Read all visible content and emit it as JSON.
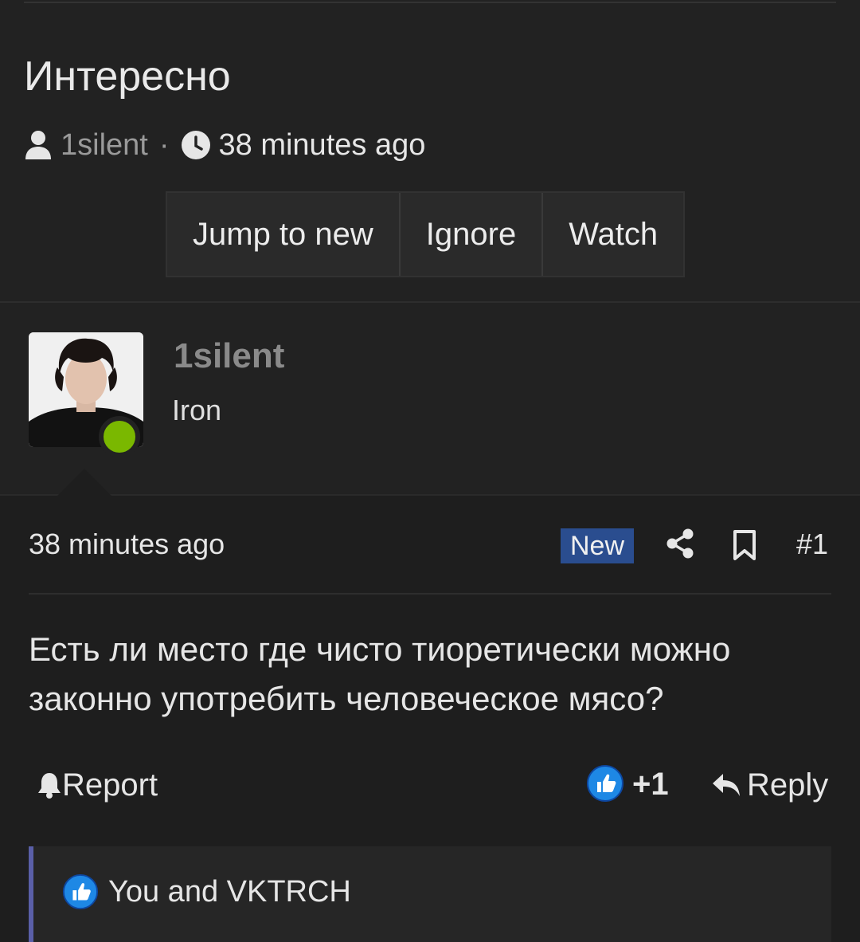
{
  "thread": {
    "title": "Интересно",
    "author": "1silent",
    "separator": "·",
    "time": "38 minutes ago"
  },
  "actions": {
    "jump_to_new": "Jump to new",
    "ignore": "Ignore",
    "watch": "Watch"
  },
  "user": {
    "name": "1silent",
    "title": "Iron",
    "status": "online"
  },
  "post": {
    "time": "38 minutes ago",
    "badge": "New",
    "number": "#1",
    "body": "Есть ли место где чисто тиоретически можно законно употребить человеческое мясо?",
    "report_label": "Report",
    "like_count": "+1",
    "reply_label": "Reply",
    "reactions_text": "You and VKTRCH"
  },
  "icons": {
    "author": "user-icon",
    "time": "clock-icon",
    "share": "share-icon",
    "bookmark": "bookmark-icon",
    "report": "bell-icon",
    "like": "thumbs-up-icon",
    "reply": "reply-icon"
  },
  "colors": {
    "background": "#222222",
    "post_background": "#1e1e1e",
    "badge_new": "#2a4d8f",
    "online": "#7ab800",
    "like_blue": "#1e88e5",
    "reactions_border": "#5a5fa8"
  }
}
